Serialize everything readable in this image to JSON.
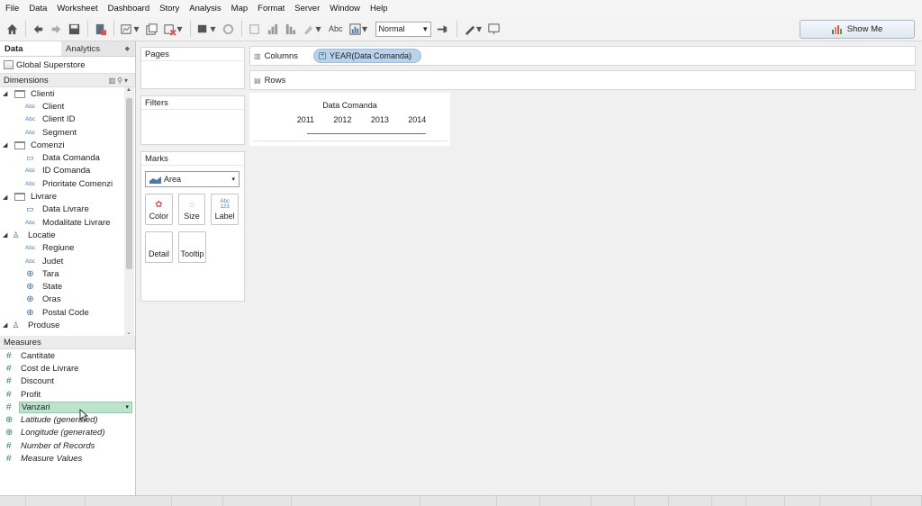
{
  "menu": [
    "File",
    "Data",
    "Worksheet",
    "Dashboard",
    "Story",
    "Analysis",
    "Map",
    "Format",
    "Server",
    "Window",
    "Help"
  ],
  "toolbar": {
    "abc_label": "Abc",
    "fit_value": "Normal",
    "show_me_label": "Show Me"
  },
  "data_pane": {
    "tabs": [
      "Data",
      "Analytics"
    ],
    "datasource": "Global Superstore",
    "dimensions_label": "Dimensions",
    "dimensions": [
      {
        "label": "Clienti",
        "kind": "folder"
      },
      {
        "label": "Client",
        "kind": "abc"
      },
      {
        "label": "Client ID",
        "kind": "abc"
      },
      {
        "label": "Segment",
        "kind": "abc"
      },
      {
        "label": "Comenzi",
        "kind": "folder"
      },
      {
        "label": "Data Comanda",
        "kind": "date"
      },
      {
        "label": "ID Comanda",
        "kind": "abc"
      },
      {
        "label": "Prioritate Comenzi",
        "kind": "abc"
      },
      {
        "label": "Livrare",
        "kind": "folder"
      },
      {
        "label": "Data Livrare",
        "kind": "date"
      },
      {
        "label": "Modalitate Livrare",
        "kind": "abc"
      },
      {
        "label": "Locatie",
        "kind": "hierarchy"
      },
      {
        "label": "Regiune",
        "kind": "abc"
      },
      {
        "label": "Judet",
        "kind": "abc"
      },
      {
        "label": "Tara",
        "kind": "geo"
      },
      {
        "label": "State",
        "kind": "geo"
      },
      {
        "label": "Oras",
        "kind": "geo"
      },
      {
        "label": "Postal Code",
        "kind": "geo"
      },
      {
        "label": "Produse",
        "kind": "hierarchy"
      }
    ],
    "measures_label": "Measures",
    "measures": [
      {
        "label": "Cantitate",
        "kind": "measure"
      },
      {
        "label": "Cost de Livrare",
        "kind": "measure"
      },
      {
        "label": "Discount",
        "kind": "measure"
      },
      {
        "label": "Profit",
        "kind": "measure"
      },
      {
        "label": "Vanzari",
        "kind": "measure",
        "selected": true
      },
      {
        "label": "Latitude (generated)",
        "kind": "geo-generated"
      },
      {
        "label": "Longitude (generated)",
        "kind": "geo-generated"
      },
      {
        "label": "Number of Records",
        "kind": "measure"
      },
      {
        "label": "Measure Values",
        "kind": "measure"
      }
    ]
  },
  "cards": {
    "pages": "Pages",
    "filters": "Filters",
    "marks": "Marks",
    "mark_type": "Area",
    "mark_buttons": [
      "Color",
      "Size",
      "Label",
      "Detail",
      "Tooltip"
    ],
    "label_icon_text": "Abc\n123"
  },
  "shelves": {
    "columns_label": "Columns",
    "columns_pill": "YEAR(Data Comanda)",
    "rows_label": "Rows"
  },
  "view": {
    "header": "Data Comanda",
    "years": [
      "2011",
      "2012",
      "2013",
      "2014"
    ]
  },
  "colors": {
    "pill": "#b9d3ec",
    "measure_green": "#2c8a55",
    "selected_measure": "#bde3cd",
    "line": "#4e79a7"
  }
}
